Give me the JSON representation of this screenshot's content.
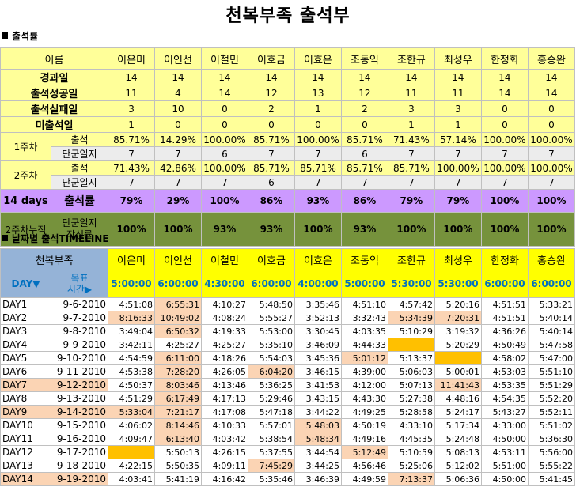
{
  "title": "천복부족 출석부",
  "section1": "출석률",
  "section2": "날짜별 출석TIMELINE",
  "names_header": "이름",
  "names": [
    "이은미",
    "이인선",
    "이철민",
    "이호금",
    "이효은",
    "조동익",
    "조한규",
    "최성우",
    "한정화",
    "홍승완"
  ],
  "summary_rows": [
    {
      "label": "경과일",
      "values": [
        "14",
        "14",
        "14",
        "14",
        "14",
        "14",
        "14",
        "14",
        "14",
        "14"
      ]
    },
    {
      "label": "출석성공일",
      "values": [
        "11",
        "4",
        "14",
        "12",
        "13",
        "12",
        "11",
        "11",
        "14",
        "14"
      ]
    },
    {
      "label": "출석실패일",
      "values": [
        "3",
        "10",
        "0",
        "2",
        "1",
        "2",
        "3",
        "3",
        "0",
        "0"
      ]
    },
    {
      "label": "미출석일",
      "values": [
        "1",
        "0",
        "0",
        "0",
        "0",
        "0",
        "1",
        "1",
        "0",
        "0"
      ]
    }
  ],
  "weeks": [
    {
      "label": "1주차",
      "attend_label": "출석",
      "attend": [
        "85.71%",
        "14.29%",
        "100.00%",
        "85.71%",
        "100.00%",
        "85.71%",
        "71.43%",
        "57.14%",
        "100.00%",
        "100.00%"
      ],
      "journal_label": "단군일지",
      "journal": [
        "7",
        "7",
        "6",
        "7",
        "7",
        "6",
        "7",
        "7",
        "7",
        "7"
      ]
    },
    {
      "label": "2주차",
      "attend_label": "출석",
      "attend": [
        "71.43%",
        "42.86%",
        "100.00%",
        "85.71%",
        "85.71%",
        "85.71%",
        "85.71%",
        "100.00%",
        "100.00%",
        "100.00%"
      ],
      "journal_label": "단군일지",
      "journal": [
        "7",
        "7",
        "7",
        "6",
        "7",
        "7",
        "7",
        "7",
        "7",
        "7"
      ]
    }
  ],
  "days14": {
    "label": "14 days",
    "sub": "출석률",
    "values": [
      "79%",
      "29%",
      "100%",
      "86%",
      "93%",
      "86%",
      "79%",
      "79%",
      "100%",
      "100%"
    ]
  },
  "cumulative": {
    "label": "2주차누적",
    "sub": "단군일지\n작성률",
    "values": [
      "100%",
      "100%",
      "93%",
      "93%",
      "100%",
      "93%",
      "100%",
      "100%",
      "100%",
      "100%"
    ]
  },
  "timeline": {
    "group_label": "천복부족",
    "day_label": "DAY▼",
    "target_label": "목표\n시간▶",
    "targets": [
      "5:00:00",
      "6:00:00",
      "4:30:00",
      "6:00:00",
      "4:00:00",
      "5:00:00",
      "5:30:00",
      "5:30:00",
      "6:00:00",
      "6:00:00"
    ],
    "rows": [
      {
        "day": "DAY1",
        "date": "9-6-2010",
        "times": [
          "4:51:08",
          "6:55:31",
          "4:10:27",
          "5:48:50",
          "3:35:46",
          "4:51:10",
          "4:57:42",
          "5:20:16",
          "4:51:51",
          "5:33:21"
        ],
        "hl": [
          1
        ]
      },
      {
        "day": "DAY2",
        "date": "9-7-2010",
        "times": [
          "8:16:33",
          "10:49:02",
          "4:08:24",
          "5:55:27",
          "3:52:13",
          "3:32:43",
          "5:34:39",
          "7:20:31",
          "4:51:51",
          "5:40:14"
        ],
        "hl": [
          0,
          1,
          6,
          7
        ]
      },
      {
        "day": "DAY3",
        "date": "9-8-2010",
        "times": [
          "3:49:04",
          "6:50:32",
          "4:19:33",
          "5:53:00",
          "3:30:45",
          "4:03:35",
          "5:10:29",
          "3:19:32",
          "4:36:26",
          "5:40:14"
        ],
        "hl": [
          1
        ]
      },
      {
        "day": "DAY4",
        "date": "9-9-2010",
        "times": [
          "3:42:11",
          "4:25:27",
          "4:25:27",
          "5:35:10",
          "3:46:09",
          "4:44:33",
          "",
          "5:20:29",
          "4:50:49",
          "5:47:58"
        ],
        "or": [
          6
        ]
      },
      {
        "day": "DAY5",
        "date": "9-10-2010",
        "times": [
          "4:54:59",
          "6:11:00",
          "4:18:26",
          "5:54:03",
          "3:45:36",
          "5:01:12",
          "5:13:37",
          "",
          "4:58:02",
          "5:47:00"
        ],
        "hl": [
          1,
          5
        ],
        "or": [
          7
        ]
      },
      {
        "day": "DAY6",
        "date": "9-11-2010",
        "times": [
          "4:53:38",
          "7:28:20",
          "4:26:05",
          "6:04:20",
          "3:46:15",
          "4:39:00",
          "5:06:03",
          "5:00:01",
          "4:53:03",
          "5:51:10"
        ],
        "hl": [
          1,
          3
        ]
      },
      {
        "day": "DAY7",
        "date": "9-12-2010",
        "times": [
          "4:50:37",
          "8:03:46",
          "4:13:46",
          "5:36:25",
          "3:41:53",
          "4:12:00",
          "5:07:13",
          "11:41:43",
          "4:53:35",
          "5:51:29"
        ],
        "hl": [
          1,
          7
        ],
        "dayhl": true
      },
      {
        "day": "DAY8",
        "date": "9-13-2010",
        "times": [
          "4:51:29",
          "6:17:49",
          "4:17:13",
          "5:29:46",
          "3:43:15",
          "4:43:30",
          "5:27:38",
          "4:48:16",
          "4:54:35",
          "5:52:20"
        ],
        "hl": [
          1
        ]
      },
      {
        "day": "DAY9",
        "date": "9-14-2010",
        "times": [
          "5:33:04",
          "7:21:17",
          "4:17:08",
          "5:47:18",
          "3:44:22",
          "4:49:25",
          "5:28:58",
          "5:24:17",
          "5:43:27",
          "5:52:11"
        ],
        "hl": [
          0,
          1
        ],
        "dayhl": true
      },
      {
        "day": "DAY10",
        "date": "9-15-2010",
        "times": [
          "4:06:02",
          "8:14:46",
          "4:10:33",
          "5:57:01",
          "5:48:03",
          "4:50:19",
          "4:33:10",
          "5:17:34",
          "4:33:00",
          "5:51:02"
        ],
        "hl": [
          1,
          4
        ]
      },
      {
        "day": "DAY11",
        "date": "9-16-2010",
        "times": [
          "4:09:47",
          "6:13:40",
          "4:03:42",
          "5:38:54",
          "5:48:34",
          "4:49:16",
          "4:45:35",
          "5:24:48",
          "4:50:00",
          "5:36:30"
        ],
        "hl": [
          1,
          4
        ]
      },
      {
        "day": "DAY12",
        "date": "9-17-2010",
        "times": [
          "",
          "5:50:13",
          "4:26:15",
          "5:37:55",
          "3:44:54",
          "5:12:49",
          "5:10:59",
          "5:08:13",
          "4:53:11",
          "5:56:00"
        ],
        "or": [
          0
        ],
        "hl": [
          5
        ]
      },
      {
        "day": "DAY13",
        "date": "9-18-2010",
        "times": [
          "4:22:15",
          "5:50:35",
          "4:09:11",
          "7:45:29",
          "3:44:25",
          "4:56:46",
          "5:25:06",
          "5:12:02",
          "5:51:00",
          "5:55:22"
        ],
        "hl": [
          3
        ]
      },
      {
        "day": "DAY14",
        "date": "9-19-2010",
        "times": [
          "4:03:41",
          "5:41:19",
          "4:16:42",
          "5:35:46",
          "3:46:39",
          "4:49:59",
          "7:13:37",
          "5:06:36",
          "4:50:00",
          "5:41:45"
        ],
        "hl": [
          6
        ],
        "dayhl": true
      }
    ]
  }
}
